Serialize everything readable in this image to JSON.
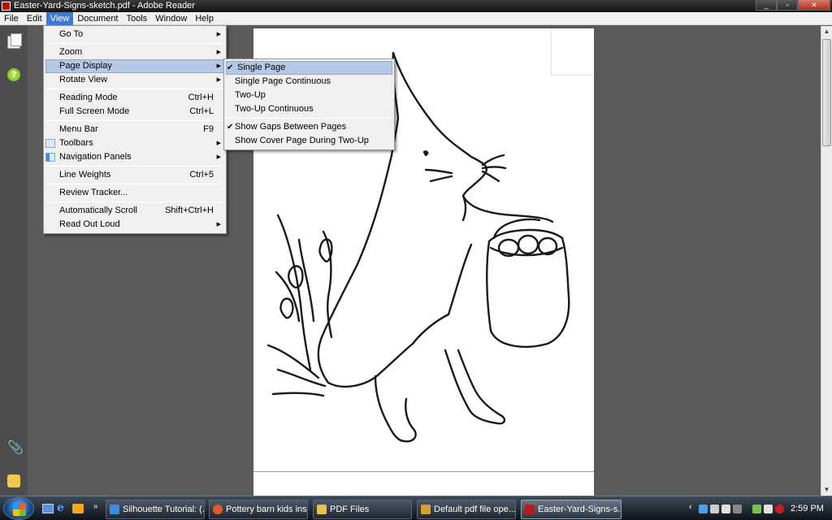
{
  "window": {
    "title": "Easter-Yard-Signs-sketch.pdf - Adobe Reader",
    "controls": [
      "minimize",
      "maximize",
      "close"
    ]
  },
  "menubar": {
    "items": [
      "File",
      "Edit",
      "View",
      "Document",
      "Tools",
      "Window",
      "Help"
    ],
    "active": "View"
  },
  "view_menu": {
    "items": [
      {
        "label": "Go To",
        "shortcut": "",
        "submenu": true
      },
      {
        "label": "Zoom",
        "shortcut": "",
        "submenu": true
      },
      {
        "label": "Page Display",
        "shortcut": "",
        "submenu": true,
        "highlighted": true
      },
      {
        "label": "Rotate View",
        "shortcut": "",
        "submenu": true
      },
      {
        "label": "Reading Mode",
        "shortcut": "Ctrl+H",
        "submenu": false
      },
      {
        "label": "Full Screen Mode",
        "shortcut": "Ctrl+L",
        "submenu": false
      },
      {
        "label": "Menu Bar",
        "shortcut": "F9",
        "submenu": false
      },
      {
        "label": "Toolbars",
        "shortcut": "",
        "submenu": true
      },
      {
        "label": "Navigation Panels",
        "shortcut": "",
        "submenu": true
      },
      {
        "label": "Line Weights",
        "shortcut": "Ctrl+5",
        "submenu": false
      },
      {
        "label": "Review Tracker...",
        "shortcut": "",
        "submenu": false
      },
      {
        "label": "Automatically Scroll",
        "shortcut": "Shift+Ctrl+H",
        "submenu": false
      },
      {
        "label": "Read Out Loud",
        "shortcut": "",
        "submenu": true
      }
    ]
  },
  "page_display_menu": {
    "items": [
      {
        "label": "Single Page",
        "checked": true,
        "highlighted": true
      },
      {
        "label": "Single Page Continuous",
        "checked": false
      },
      {
        "label": "Two-Up",
        "checked": false
      },
      {
        "label": "Two-Up Continuous",
        "checked": false
      },
      {
        "label": "Show Gaps Between Pages",
        "checked": true
      },
      {
        "label": "Show Cover Page During Two-Up",
        "checked": false
      }
    ],
    "check_glyph": "✔"
  },
  "icons": {
    "submenu_arrow": "▶",
    "scroll_up": "▲",
    "scroll_down": "▼",
    "help": "?",
    "attachment": "📎",
    "quicklaunch_more": "»",
    "tray_chevron": "‹"
  },
  "taskbar": {
    "tasks": [
      {
        "label": "Silhouette Tutorial: (...",
        "icon_color": "#3c8de0",
        "active": false
      },
      {
        "label": "Pottery barn kids ins...",
        "icon_color": "#e05a2a",
        "active": false
      },
      {
        "label": "PDF Files",
        "icon_color": "#e8c04a",
        "active": false
      },
      {
        "label": "Default pdf file ope...",
        "icon_color": "#d8a030",
        "active": false
      },
      {
        "label": "Easter-Yard-Signs-s...",
        "icon_color": "#c01818",
        "active": true
      }
    ],
    "clock": "2:59 PM"
  },
  "colors": {
    "menu_highlight": "#b5c9e6",
    "active_menu": "#3d7ad6",
    "workspace": "#5a5a5a"
  }
}
